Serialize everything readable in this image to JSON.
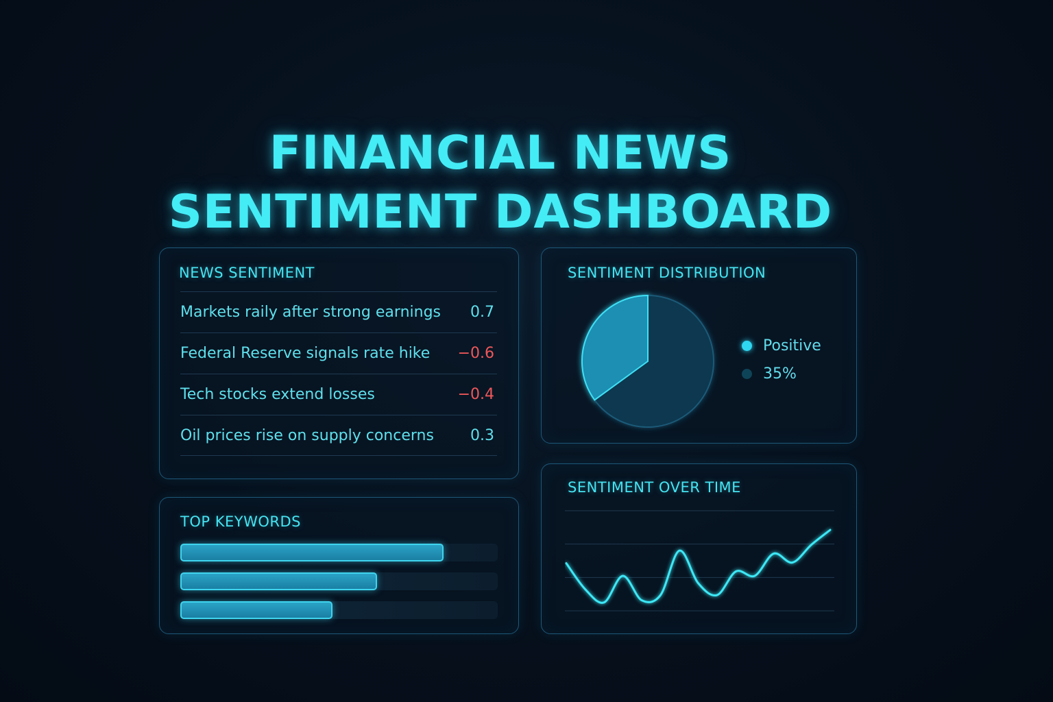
{
  "header": {
    "title_line1": "FINANCIAL NEWS",
    "title_line2": "SENTIMENT DASHBOARD"
  },
  "news_sentiment": {
    "title": "NEWS SENTIMENT",
    "items": [
      {
        "headline": "Markets raily after strong earnings",
        "score": "0.7",
        "polarity": "positive"
      },
      {
        "headline": "Federal Reserve signals rate hike",
        "score": "−0.6",
        "polarity": "negative"
      },
      {
        "headline": "Tech stocks extend losses",
        "score": "−0.4",
        "polarity": "negative"
      },
      {
        "headline": "Oil prices rise on supply concerns",
        "score": "0.3",
        "polarity": "positive"
      }
    ]
  },
  "top_keywords": {
    "title": "TOP KEYWORDS",
    "bars": [
      0.83,
      0.62,
      0.48
    ]
  },
  "sentiment_distribution": {
    "title": "SENTIMENT DISTRIBUTION",
    "legend": [
      {
        "label": "Positive",
        "color": "#2fd6f0"
      },
      {
        "label": "35%",
        "color": "#0e4458"
      }
    ],
    "slices": [
      {
        "value": 35,
        "color": "#1b8fb3"
      },
      {
        "value": 65,
        "color": "#0c3850"
      }
    ]
  },
  "sentiment_over_time": {
    "title": "SENTIMENT OVER TIME",
    "values": [
      0.55,
      0.2,
      0.02,
      0.38,
      0.05,
      0.12,
      0.72,
      0.28,
      0.12,
      0.44,
      0.38,
      0.68,
      0.56,
      0.8,
      1.0
    ],
    "gridlines": 4
  },
  "colors": {
    "accent": "#3fe6f2",
    "negative": "#f0575a",
    "panel_border": "#1d5878"
  }
}
